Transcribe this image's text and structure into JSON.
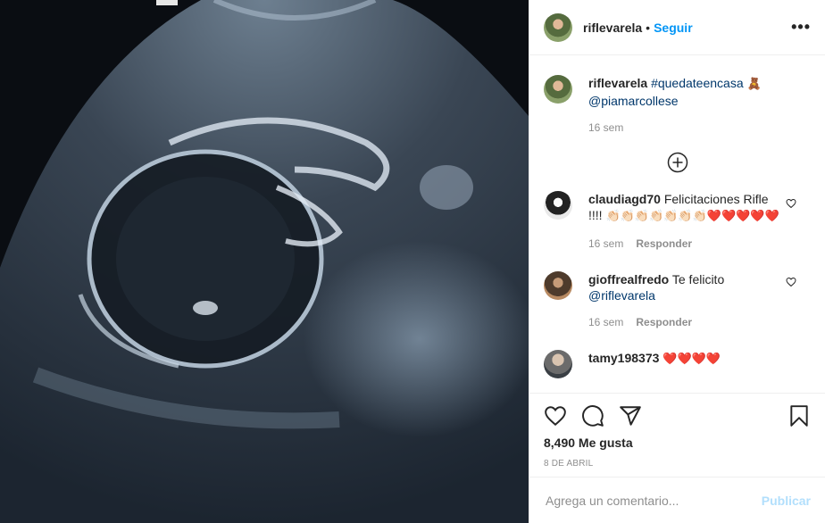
{
  "header": {
    "username": "riflevarela",
    "separator": "•",
    "follow_label": "Seguir",
    "more_label": "•••"
  },
  "caption": {
    "username": "riflevarela",
    "hashtag": "#quedateencasa",
    "emoji": "🧸",
    "mention": "@piamarcollese",
    "time": "16 sem"
  },
  "comments": [
    {
      "username": "claudiagd70",
      "text": "Felicitaciones Rifle !!!!",
      "emojis": "👏🏻👏🏻👏🏻👏🏻👏🏻👏🏻👏🏻❤️❤️❤️❤️❤️",
      "time": "16 sem",
      "reply": "Responder"
    },
    {
      "username": "gioffrealfredo",
      "text": "Te felicito",
      "mention": "@riflevarela",
      "time": "16 sem",
      "reply": "Responder"
    },
    {
      "username": "tamy198373",
      "emojis": "❤️❤️❤️❤️"
    }
  ],
  "likes": "8,490 Me gusta",
  "date": "8 DE ABRIL",
  "add_comment": {
    "placeholder": "Agrega un comentario...",
    "publish_label": "Publicar"
  },
  "icons": [
    "heart-icon",
    "comment-icon",
    "share-icon",
    "bookmark-icon",
    "plus-circle-icon"
  ]
}
